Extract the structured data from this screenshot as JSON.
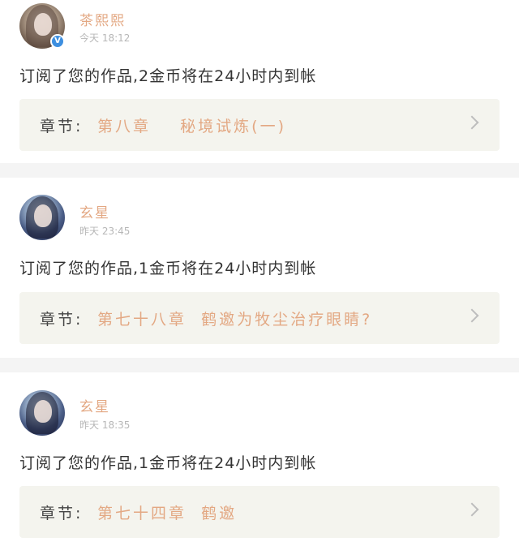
{
  "notifications": [
    {
      "username": "茶熙熙",
      "verified": true,
      "timestamp": "今天 18:12",
      "message": "订阅了您的作品,2金币将在24小时内到帐",
      "chapter_label": "章节:",
      "chapter_title": "第八章    秘境试炼(一)"
    },
    {
      "username": "玄星",
      "verified": false,
      "timestamp": "昨天 23:45",
      "message": "订阅了您的作品,1金币将在24小时内到帐",
      "chapter_label": "章节:",
      "chapter_title": "第七十八章  鹤邀为牧尘治疗眼睛?"
    },
    {
      "username": "玄星",
      "verified": false,
      "timestamp": "昨天 18:35",
      "message": "订阅了您的作品,1金币将在24小时内到帐",
      "chapter_label": "章节:",
      "chapter_title": "第七十四章  鹤邀"
    }
  ],
  "icons": {
    "verified_badge": "verified-icon",
    "chevron": "chevron-right-icon"
  },
  "colors": {
    "accent": "#e3a883",
    "badge_blue": "#3d8fe0",
    "chapter_bg": "#f4f4ee",
    "separator": "#f4f4f4",
    "timestamp_gray": "#b7b7b7"
  }
}
